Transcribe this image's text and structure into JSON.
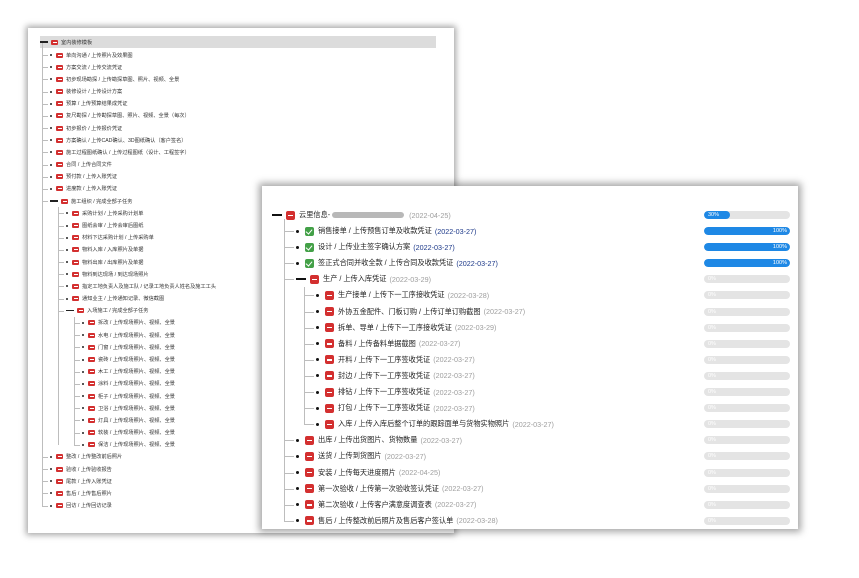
{
  "small_panel": {
    "root": "室内装修模板",
    "items": [
      {
        "label": "单向沟通 / 上传照片及效果图"
      },
      {
        "label": "方案交流 / 上传交流凭证"
      },
      {
        "label": "初步现场勘探 / 上传勘探草图、照片、视频、全景"
      },
      {
        "label": "装修设计 / 上传设计方案"
      },
      {
        "label": "预算 / 上传预算结果成凭证"
      },
      {
        "label": "复尺勘探 / 上传勘探草图、照片、视频、全景（每次）"
      },
      {
        "label": "初步报价 / 上传报价凭证"
      },
      {
        "label": "方案确认 / 上传CAD确认、3D图纸确认（客户签名）"
      },
      {
        "label": "施工过程图纸确认 / 上传过程图纸（设计、工程签字）"
      },
      {
        "label": "合同 / 上传合同文件"
      },
      {
        "label": "预付款 / 上传入账凭证"
      },
      {
        "label": "进度款 / 上传入账凭证"
      },
      {
        "label": "施工组织 / 完成全部子任务",
        "children": [
          {
            "label": "采购计划 / 上传采购计划单"
          },
          {
            "label": "图纸会审 / 上传会审后图纸"
          },
          {
            "label": "材料下达采购计划 / 上传采购单"
          },
          {
            "label": "物料入库 / 入库照片及单据"
          },
          {
            "label": "物料出库 / 出库照片及单据"
          },
          {
            "label": "物料到达现场 / 到达现场照片"
          },
          {
            "label": "指定工地负责人及施工队 / 记录工地负责人姓名及施工工头"
          },
          {
            "label": "通知业主 / 上传通知记录、微信截图"
          },
          {
            "label": "入场施工 / 完成全部子任务",
            "children": [
              {
                "label": "拆改 / 上传现场照片、视频、全景"
              },
              {
                "label": "水电 / 上传现场照片、视频、全景"
              },
              {
                "label": "门窗 / 上传现场照片、视频、全景"
              },
              {
                "label": "瓷砖 / 上传现场照片、视频、全景"
              },
              {
                "label": "木工 / 上传现场照片、视频、全景"
              },
              {
                "label": "涂料 / 上传现场照片、视频、全景"
              },
              {
                "label": "柜子 / 上传现场照片、视频、全景"
              },
              {
                "label": "卫浴 / 上传现场照片、视频、全景"
              },
              {
                "label": "灯具 / 上传现场照片、视频、全景"
              },
              {
                "label": "软装 / 上传现场照片、视频、全景"
              },
              {
                "label": "保洁 / 上传现场照片、视频、全景"
              }
            ]
          }
        ]
      },
      {
        "label": "整改 / 上传整改前后照片"
      },
      {
        "label": "验收 / 上传验收报告"
      },
      {
        "label": "尾款 / 上传入账凭证"
      },
      {
        "label": "售后 / 上传售后照片"
      },
      {
        "label": "回访 / 上传回访记录"
      }
    ]
  },
  "large_panel": {
    "root": {
      "label": "云里信息-",
      "date": "(2022-04-25)",
      "progress": "30%"
    },
    "items": [
      {
        "label": "销售接单 / 上传预售订单及收款凭证",
        "date": "(2022-03-27)",
        "progress": "100%",
        "status": "done",
        "date_style": "blue"
      },
      {
        "label": "设计 / 上传业主签字确认方案",
        "date": "(2022-03-27)",
        "progress": "100%",
        "status": "done",
        "date_style": "blue"
      },
      {
        "label": "签正式合同并收全款 / 上传合同及收款凭证",
        "date": "(2022-03-27)",
        "progress": "100%",
        "status": "done",
        "date_style": "blue"
      },
      {
        "label": "生产 / 上传入库凭证",
        "date": "(2022-03-29)",
        "progress": "0%",
        "status": "todo",
        "date_style": "grey",
        "expanded": true,
        "children": [
          {
            "label": "生产接单 / 上传下一工序接收凭证",
            "date": "(2022-03-28)",
            "progress": "0%"
          },
          {
            "label": "外协五金配件、门板订购 / 上传订单订购截图",
            "date": "(2022-03-27)",
            "progress": "0%"
          },
          {
            "label": "拆单、导单 / 上传下一工序接收凭证",
            "date": "(2022-03-29)",
            "progress": "0%"
          },
          {
            "label": "备料 / 上传备料单据截图",
            "date": "(2022-03-27)",
            "progress": "0%"
          },
          {
            "label": "开料 / 上传下一工序签收凭证",
            "date": "(2022-03-27)",
            "progress": "0%"
          },
          {
            "label": "封边 / 上传下一工序签收凭证",
            "date": "(2022-03-27)",
            "progress": "0%"
          },
          {
            "label": "排钻 / 上传下一工序签收凭证",
            "date": "(2022-03-27)",
            "progress": "0%"
          },
          {
            "label": "打包 / 上传下一工序签收凭证",
            "date": "(2022-03-27)",
            "progress": "0%"
          },
          {
            "label": "入库 / 上传入库后整个订单的跟踪面单与货物实物照片",
            "date": "(2022-03-27)",
            "progress": "0%"
          }
        ]
      },
      {
        "label": "出库 / 上传出货图片、货物数量",
        "date": "(2022-03-27)",
        "progress": "0%",
        "status": "todo",
        "date_style": "grey"
      },
      {
        "label": "送货 / 上传到货图片",
        "date": "(2022-03-27)",
        "progress": "0%",
        "status": "todo",
        "date_style": "grey"
      },
      {
        "label": "安装 / 上传每天进度照片",
        "date": "(2022-04-25)",
        "progress": "0%",
        "status": "todo",
        "date_style": "grey"
      },
      {
        "label": "第一次验收 / 上传第一次验收签认凭证",
        "date": "(2022-03-27)",
        "progress": "0%",
        "status": "todo",
        "date_style": "grey"
      },
      {
        "label": "第二次验收 / 上传客户满意度调查表",
        "date": "(2022-03-27)",
        "progress": "0%",
        "status": "todo",
        "date_style": "grey"
      },
      {
        "label": "售后 / 上传整改前后照片及售后客户签认单",
        "date": "(2022-03-28)",
        "progress": "0%",
        "status": "todo",
        "date_style": "grey"
      }
    ]
  }
}
